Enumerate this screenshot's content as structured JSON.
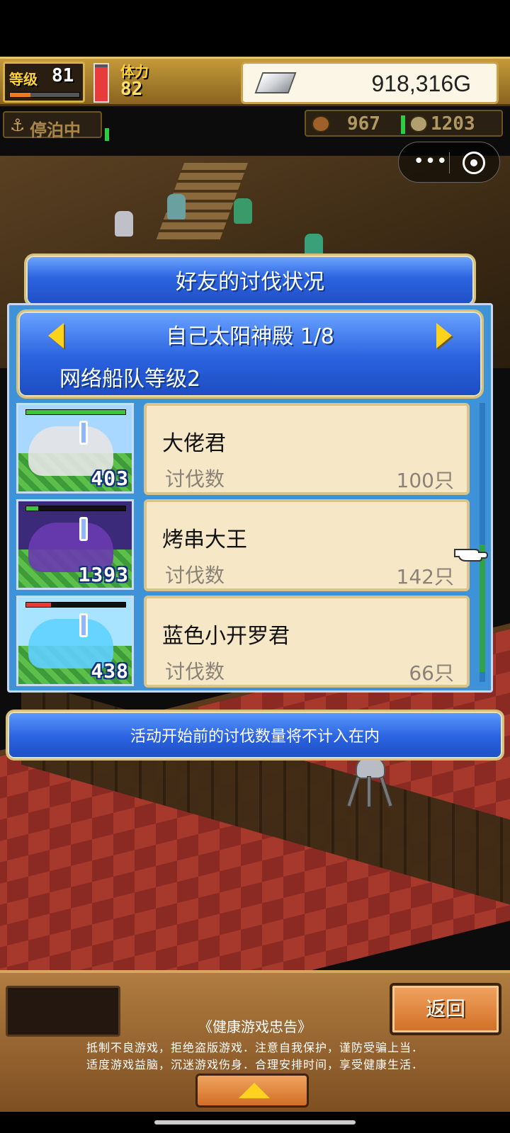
{
  "hud": {
    "level_label": "等级",
    "level_value": "81",
    "level_progress": 0.3,
    "stamina_label": "体力",
    "stamina_value": "82",
    "stamina_fill": 0.92,
    "gold_value": "918,316G"
  },
  "hud2": {
    "anchor_label": "停泊中",
    "resource1_value": "967",
    "resource2_value": "1203"
  },
  "modal": {
    "title": "好友的讨伐状况",
    "header_title": "自己太阳神殿 1/8",
    "header_subtitle": "网络船队等级2",
    "rows": [
      {
        "name": "大佬君",
        "label": "讨伐数",
        "count": "100只",
        "level": "403",
        "hp_fill": 1.0,
        "hp_color": "#3ec33e",
        "thumb_sky": "#a8d8ff",
        "monster_color": "#e6e6e6"
      },
      {
        "name": "烤串大王",
        "label": "讨伐数",
        "count": "142只",
        "level": "1393",
        "hp_fill": 0.12,
        "hp_color": "#3ec33e",
        "thumb_sky": "#3b2a7a",
        "monster_color": "#6a3ab0"
      },
      {
        "name": "蓝色小开罗君",
        "label": "讨伐数",
        "count": "66只",
        "level": "438",
        "hp_fill": 0.25,
        "hp_color": "#e83c3c",
        "thumb_sky": "#a8e4ff",
        "monster_color": "#5fd0ff"
      }
    ],
    "notice": "活动开始前的讨伐数量将不计入在内"
  },
  "bottom": {
    "back_label": "返回",
    "advisory_title": "《健康游戏忠告》",
    "advisory_line1": "抵制不良游戏，拒绝盗版游戏．注意自我保护，谨防受骗上当．",
    "advisory_line2": "适度游戏益脑，沉迷游戏伤身．合理安排时间，享受健康生活．"
  },
  "colors": {
    "accent_blue": "#2a62df",
    "card_bg": "#f6e8c6",
    "gold_text": "#ffd23a"
  }
}
